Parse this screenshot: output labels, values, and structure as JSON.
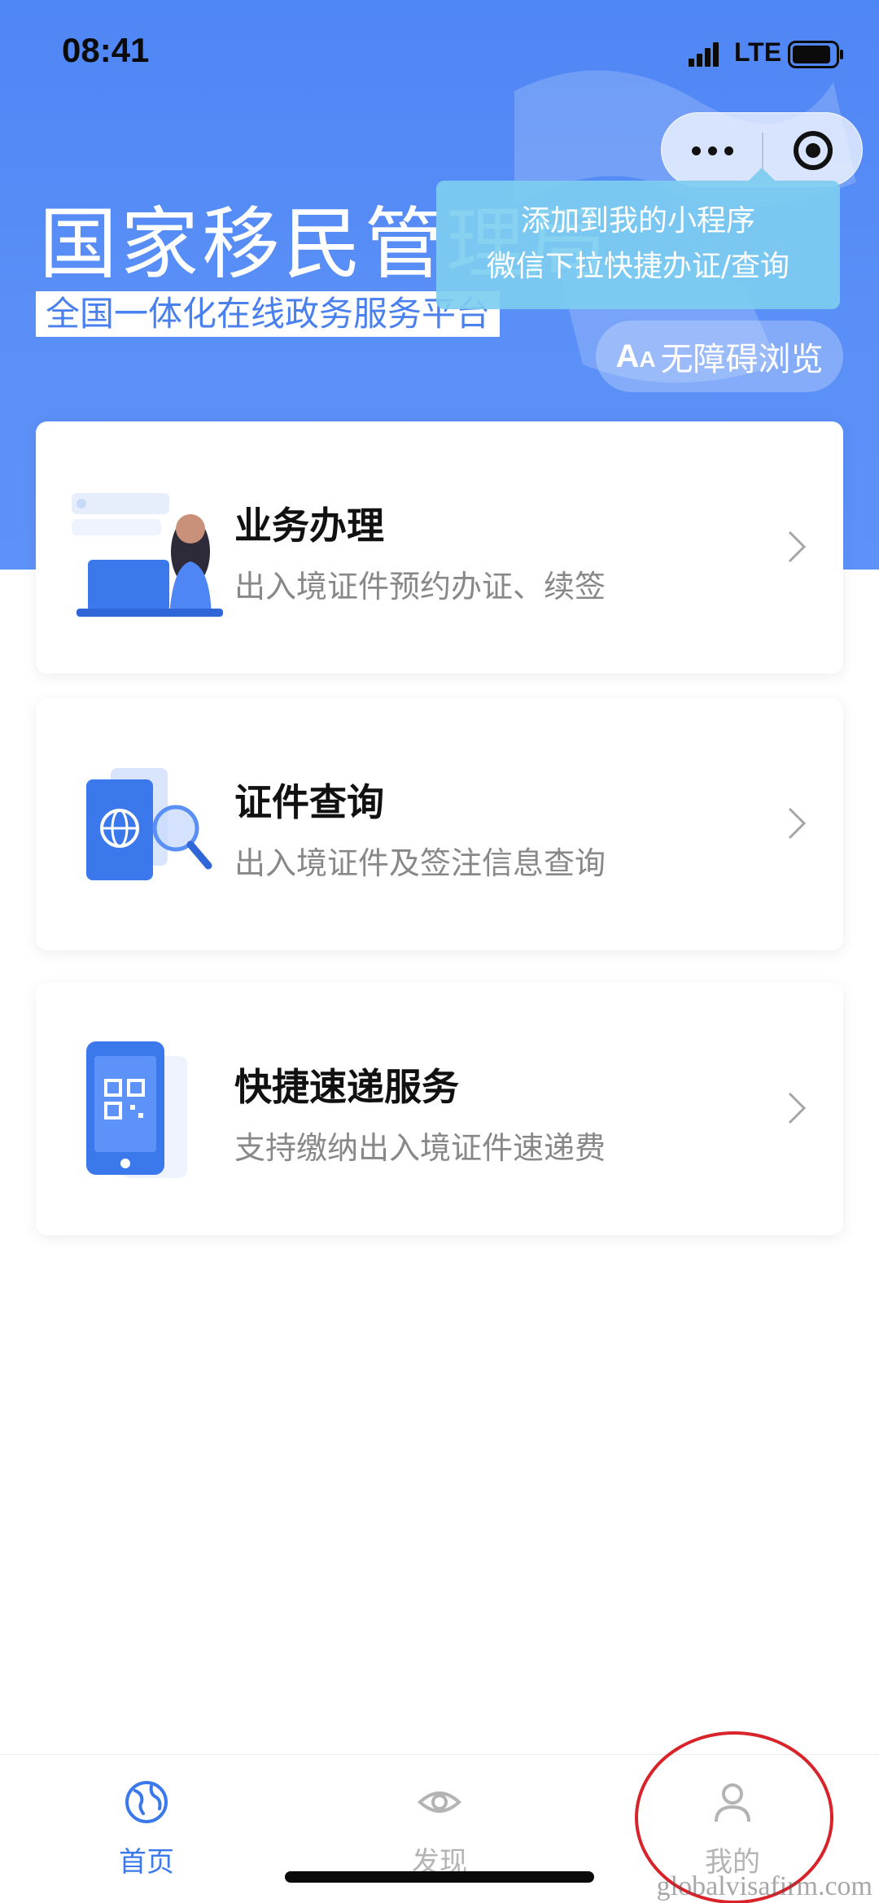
{
  "status_bar": {
    "time": "08:41",
    "network": "LTE"
  },
  "header": {
    "title": "国家移民管理局",
    "subtitle": "全国一体化在线政务服务平台",
    "tooltip_line1": "添加到我的小程序",
    "tooltip_line2": "微信下拉快捷办证/查询",
    "accessibility_icon": "A",
    "accessibility_icon_small": "A",
    "accessibility_label": "无障碍浏览"
  },
  "cards": [
    {
      "title": "业务办理",
      "description": "出入境证件预约办证、续签",
      "icon": "person-laptop-illustration"
    },
    {
      "title": "证件查询",
      "description": "出入境证件及签注信息查询",
      "icon": "passport-search-illustration"
    },
    {
      "title": "快捷速递服务",
      "description": "支持缴纳出入境证件速递费",
      "icon": "phone-qr-illustration"
    }
  ],
  "tab_bar": {
    "items": [
      {
        "label": "首页",
        "icon": "globe-icon",
        "active": true
      },
      {
        "label": "发现",
        "icon": "eye-icon",
        "active": false
      },
      {
        "label": "我的",
        "icon": "user-icon",
        "active": false
      }
    ]
  },
  "watermark": "globalvisafirm.com",
  "colors": {
    "brand": "#4f86f5",
    "active_tab": "#3a78ec",
    "inactive_tab": "#b4b4b4",
    "annotation": "#d9232b"
  }
}
